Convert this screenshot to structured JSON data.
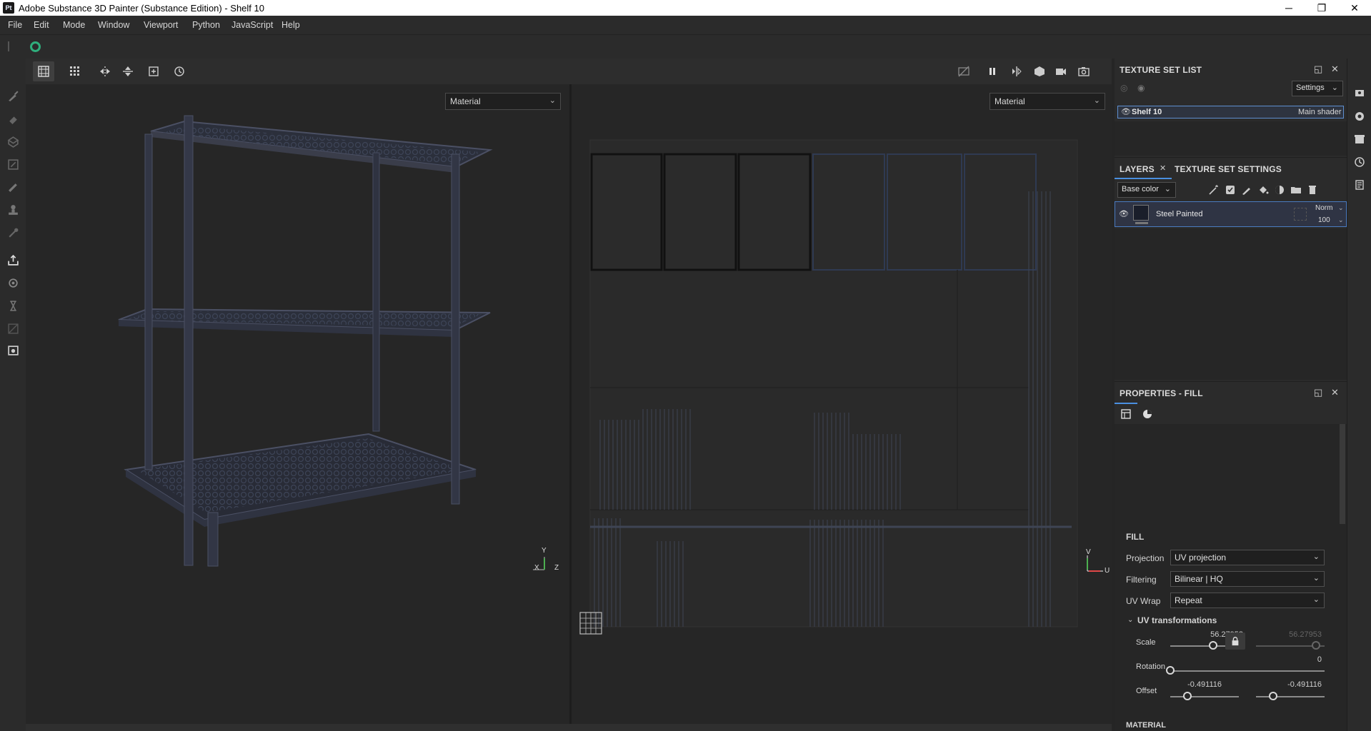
{
  "window": {
    "app_icon": "Pt",
    "title": "Adobe Substance 3D Painter (Substance Edition) - Shelf 10",
    "minimize": "─",
    "restore": "❐",
    "close": "✕"
  },
  "menu": [
    "File",
    "Edit",
    "Mode",
    "Window",
    "Viewport",
    "Python",
    "JavaScript",
    "Help"
  ],
  "viewport_3d": {
    "mode": "Material",
    "axis_y": "Y",
    "axis_x": "X",
    "axis_z": "Z"
  },
  "viewport_uv": {
    "mode": "Material",
    "axis_v": "V",
    "axis_u": "U"
  },
  "texture_set_list": {
    "title": "TEXTURE SET LIST",
    "settings_label": "Settings",
    "item_name": "Shelf 10",
    "item_shader": "Main shader"
  },
  "layers": {
    "tab_layers": "LAYERS",
    "tab_texture_set_settings": "TEXTURE SET SETTINGS",
    "channel": "Base color",
    "layer_name": "Steel Painted",
    "blend_mode": "Norm",
    "opacity": "100"
  },
  "properties": {
    "title": "PROPERTIES - FILL",
    "section_fill": "FILL",
    "projection_label": "Projection",
    "projection_value": "UV projection",
    "filtering_label": "Filtering",
    "filtering_value": "Bilinear | HQ",
    "uvwrap_label": "UV Wrap",
    "uvwrap_value": "Repeat",
    "uv_transformations": "UV transformations",
    "scale_label": "Scale",
    "scale_value": "56.27953",
    "scale_value_locked": "56.27953",
    "scale_fraction": 0.62,
    "rotation_label": "Rotation",
    "rotation_value": "0",
    "rotation_fraction": 0.0,
    "offset_label": "Offset",
    "offset_u": "-0.491116",
    "offset_v": "-0.491116",
    "offset_u_fraction": 0.25,
    "offset_v_fraction": 0.25,
    "section_material": "MATERIAL"
  }
}
